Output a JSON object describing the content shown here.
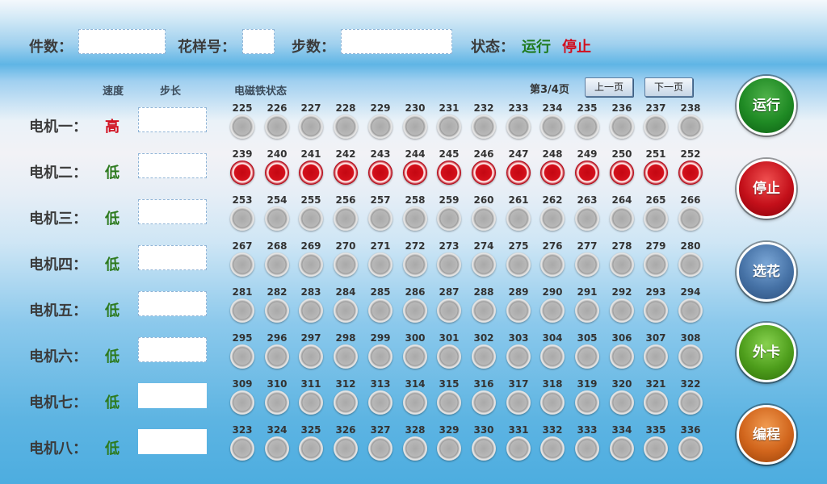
{
  "header": {
    "count_label": "件数：",
    "pattern_label": "花样号：",
    "steps_label": "步数：",
    "status_label": "状态：",
    "status_run": "运行",
    "status_stop": "停止",
    "count_value": "",
    "pattern_value": "",
    "steps_value": ""
  },
  "columns": {
    "speed": "速度",
    "step": "步长",
    "magnet_status": "电磁铁状态"
  },
  "pager": {
    "page_info": "第3/4页",
    "prev": "上一页",
    "next": "下一页"
  },
  "motors": [
    {
      "name": "电机一：",
      "speed": "高",
      "speed_color": "#d10f1f",
      "step": ""
    },
    {
      "name": "电机二：",
      "speed": "低",
      "speed_color": "#2d7a1e",
      "step": ""
    },
    {
      "name": "电机三：",
      "speed": "低",
      "speed_color": "#2d7a1e",
      "step": ""
    },
    {
      "name": "电机四：",
      "speed": "低",
      "speed_color": "#2d7a1e",
      "step": ""
    },
    {
      "name": "电机五：",
      "speed": "低",
      "speed_color": "#2d7a1e",
      "step": ""
    },
    {
      "name": "电机六：",
      "speed": "低",
      "speed_color": "#2d7a1e",
      "step": ""
    },
    {
      "name": "电机七：",
      "speed": "低",
      "speed_color": "#2d7a1e",
      "step": ""
    },
    {
      "name": "电机八：",
      "speed": "低",
      "speed_color": "#2d7a1e",
      "step": ""
    }
  ],
  "magnets": {
    "start": 225,
    "per_row": 14,
    "rows": 8,
    "active": [
      239,
      240,
      241,
      242,
      243,
      244,
      245,
      246,
      247,
      248,
      249,
      250,
      251,
      252
    ]
  },
  "side_buttons": [
    {
      "label": "运行",
      "style": "run"
    },
    {
      "label": "停止",
      "style": "stop"
    },
    {
      "label": "选花",
      "style": "pick"
    },
    {
      "label": "外卡",
      "style": "ext"
    },
    {
      "label": "编程",
      "style": "prog"
    }
  ],
  "colors": {
    "running": "#1e7a1e",
    "stopped": "#d10f1f",
    "led_on": "#c40712",
    "led_off": "#a9a9a9"
  }
}
